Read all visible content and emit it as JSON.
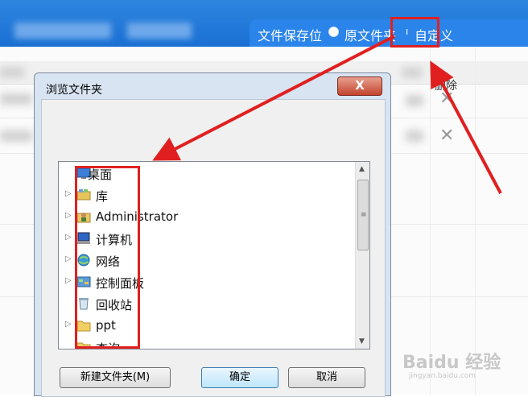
{
  "top_bar": {
    "save_location_label": "文件保存位",
    "option_original": "原文件夹",
    "option_custom": "自定义"
  },
  "background_table": {
    "delete_header": "删除",
    "delete_icon": "close-icon"
  },
  "dialog": {
    "title": "浏览文件夹",
    "close_symbol": "X",
    "folders": [
      {
        "label": "桌面",
        "icon": "desktop-icon"
      },
      {
        "label": "库",
        "icon": "library-icon"
      },
      {
        "label": "Administrator",
        "icon": "user-folder-icon"
      },
      {
        "label": "计算机",
        "icon": "computer-icon"
      },
      {
        "label": "网络",
        "icon": "network-icon"
      },
      {
        "label": "控制面板",
        "icon": "control-panel-icon"
      },
      {
        "label": "回收站",
        "icon": "recycle-bin-icon"
      },
      {
        "label": "ppt",
        "icon": "folder-icon"
      },
      {
        "label": "查询",
        "icon": "folder-icon"
      }
    ],
    "buttons": {
      "new_folder": "新建文件夹(M)",
      "ok": "确定",
      "cancel": "取消"
    }
  },
  "watermark": {
    "brand": "Baidu 经验",
    "url": "jingyan.baidu.com"
  },
  "colors": {
    "accent_blue": "#2a84ea",
    "annotation_red": "#e02020"
  }
}
